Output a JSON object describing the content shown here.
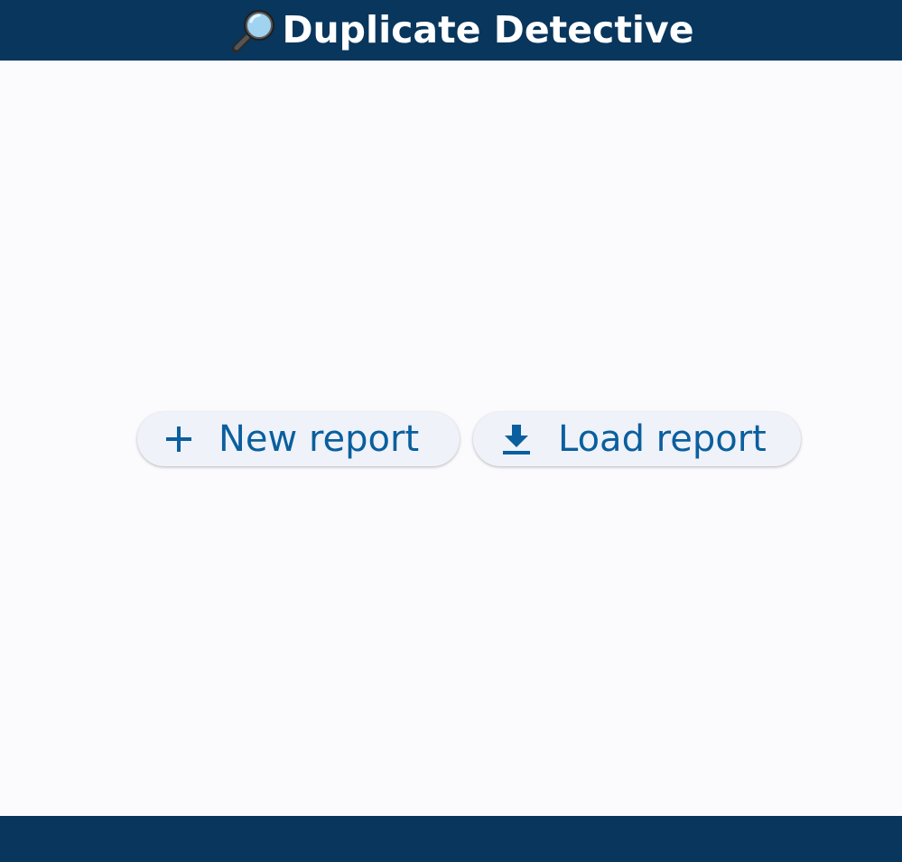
{
  "app": {
    "title": "Duplicate Detective",
    "title_icon": "magnifying-glass-icon"
  },
  "actions": {
    "new_report": {
      "label": "New report",
      "icon": "plus-icon"
    },
    "load_report": {
      "label": "Load report",
      "icon": "download-icon"
    }
  },
  "colors": {
    "header_bg": "#08365d",
    "footer_bg": "#08365d",
    "page_bg": "#fbfbfe",
    "button_bg": "#eff2f9",
    "accent": "#0a5f9e",
    "title_text": "#ffffff"
  }
}
